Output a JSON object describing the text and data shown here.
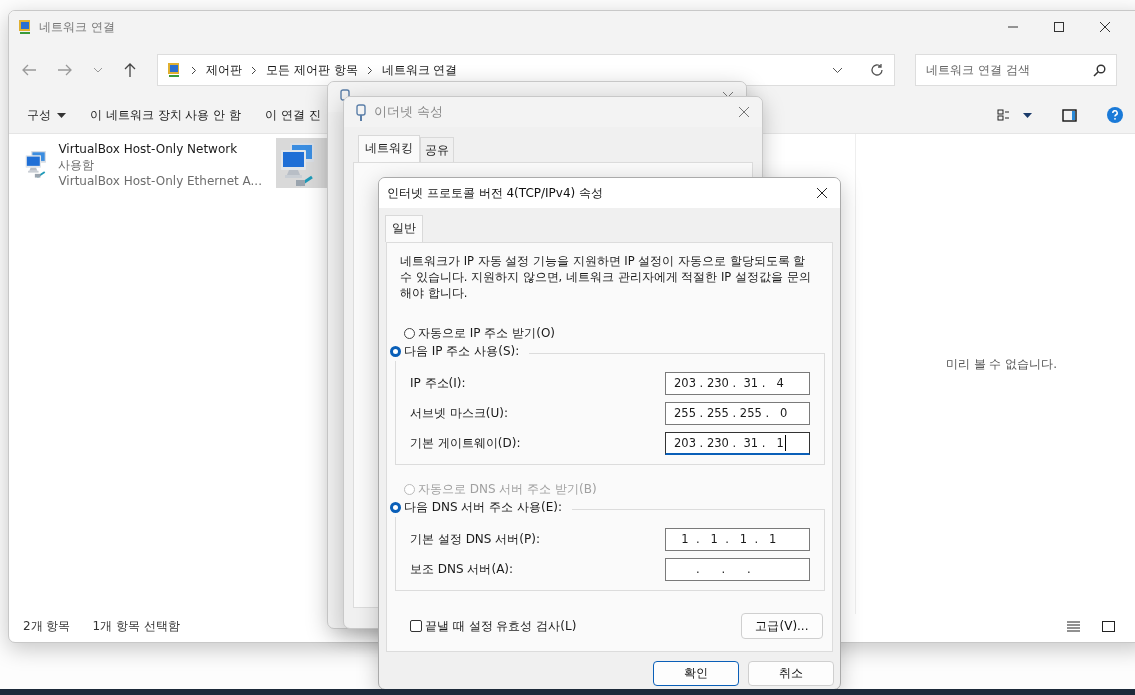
{
  "explorer": {
    "title": "네트워크 연결",
    "breadcrumb": [
      "제어판",
      "모든 제어판 항목",
      "네트워크 연결"
    ],
    "search": {
      "placeholder": "네트워크 연결 검색"
    },
    "toolbar": [
      {
        "label": "구성",
        "kind": "menu"
      },
      {
        "label": "이 네트워크 장치 사용 안 함",
        "kind": "action"
      },
      {
        "label": "이 연결 진",
        "kind": "action"
      }
    ],
    "items": [
      {
        "name": "VirtualBox Host-Only Network",
        "status": "사용함",
        "device": "VirtualBox Host-Only Ethernet A...",
        "selected": false
      },
      {
        "selected": true
      }
    ],
    "preview": "미리 볼 수 없습니다.",
    "status_bar": [
      "2개 항목",
      "1개 항목 선택함"
    ]
  },
  "properties_dialog": {
    "title": "이더넷 속성",
    "tabs": [
      {
        "label": "네트워킹",
        "selected": true
      },
      {
        "label": "공유",
        "selected": false
      }
    ]
  },
  "ipv4_dialog": {
    "title": "인터넷 프로토콜 버전 4(TCP/IPv4) 속성",
    "tabs": [
      {
        "label": "일반",
        "selected": true
      }
    ],
    "description": "네트워크가 IP 자동 설정 기능을 지원하면 IP 설정이 자동으로 할당되도록 할 수 있습니다. 지원하지 않으면, 네트워크 관리자에게 적절한 IP 설정값을 문의해야 합니다.",
    "ip_options": [
      {
        "label": "자동으로 IP 주소 받기(O)",
        "selected": false,
        "disabled": false
      },
      {
        "label": "다음 IP 주소 사용(S):",
        "selected": true,
        "disabled": false
      }
    ],
    "ip_fields": [
      {
        "label": "IP 주소(I):",
        "value": "203 . 230 .  31 .   4",
        "focused": false
      },
      {
        "label": "서브넷 마스크(U):",
        "value": "255 . 255 . 255 .   0",
        "focused": false
      },
      {
        "label": "기본 게이트웨이(D):",
        "value": "203 . 230 .  31 .   1",
        "focused": true
      }
    ],
    "dns_options": [
      {
        "label": "자동으로 DNS 서버 주소 받기(B)",
        "selected": false,
        "disabled": true
      },
      {
        "label": "다음 DNS 서버 주소 사용(E):",
        "selected": true,
        "disabled": false
      }
    ],
    "dns_fields": [
      {
        "label": "기본 설정 DNS 서버(P):",
        "value": "  1  .   1  .   1  .   1",
        "focused": false
      },
      {
        "label": "보조 DNS 서버(A):",
        "value": "      .      .      .",
        "focused": false
      }
    ],
    "validate": {
      "label": "끝낼 때 설정 유효성 검사(L)",
      "checked": false
    },
    "advanced_button": "고급(V)...",
    "buttons": [
      {
        "label": "확인",
        "default": true
      },
      {
        "label": "취소",
        "default": false
      }
    ]
  }
}
